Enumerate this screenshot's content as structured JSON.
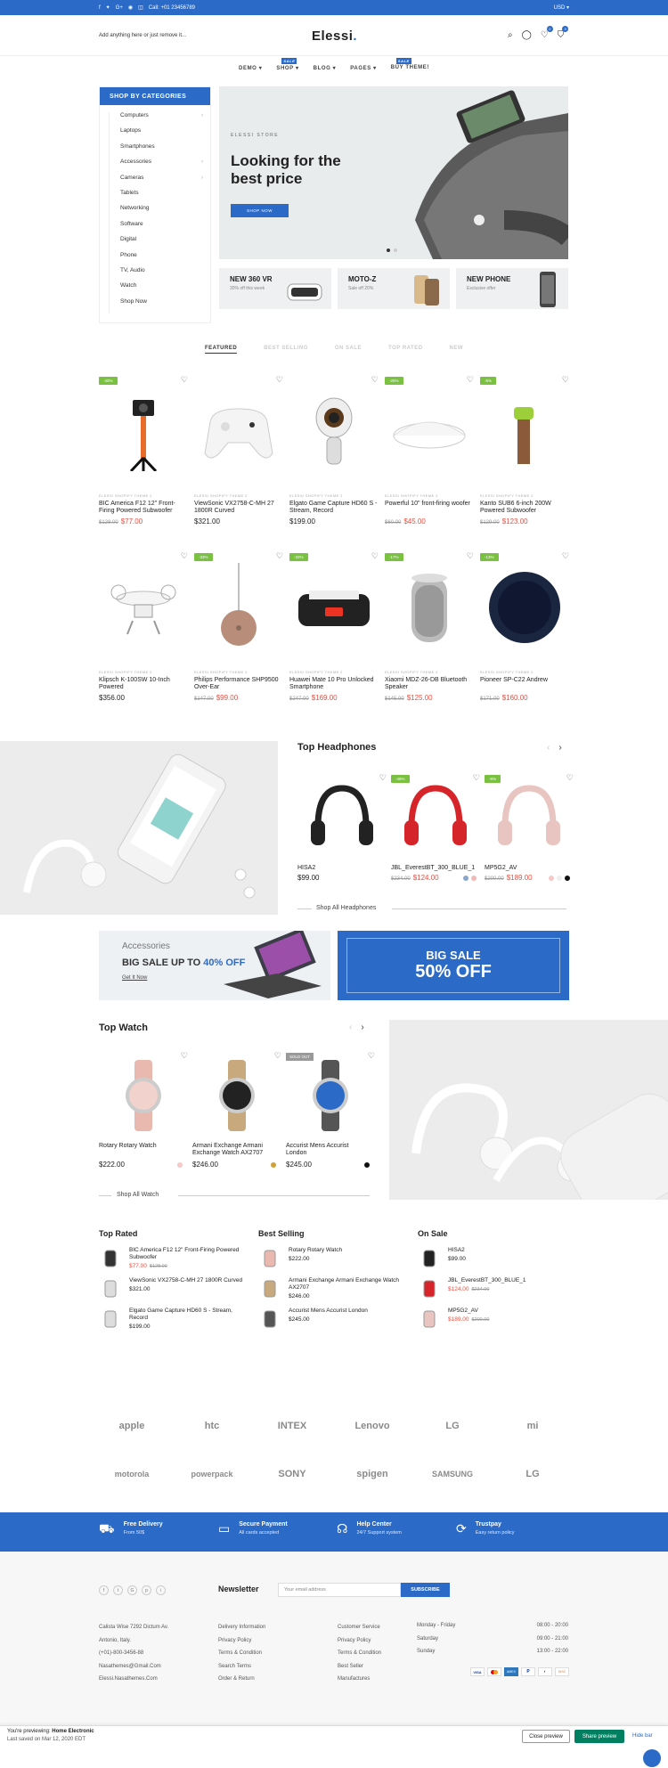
{
  "topbar": {
    "call": "Call: +01 23456789",
    "currency": "USD"
  },
  "header": {
    "search_placeholder": "Add anything here or just remove it...",
    "logo": "Elessi",
    "cart_count": "0",
    "wish_count": "0"
  },
  "nav": {
    "items": [
      {
        "label": "DEMO",
        "tag": ""
      },
      {
        "label": "SHOP",
        "tag": "SALE"
      },
      {
        "label": "BLOG",
        "tag": ""
      },
      {
        "label": "PAGES",
        "tag": ""
      },
      {
        "label": "BUY THEME!",
        "tag": "SALE"
      }
    ]
  },
  "categories": {
    "title": "SHOP BY CATEGORIES",
    "items": [
      "Computers",
      "Laptops",
      "Smartphones",
      "Accessories",
      "Cameras",
      "Tablets",
      "Networking",
      "Software",
      "Digital",
      "Phone",
      "TV, Audio",
      "Watch",
      "Shop Now"
    ]
  },
  "slider": {
    "subtitle": "ELESSI STORE",
    "title": "Looking for the best price",
    "button": "SHOP NOW"
  },
  "promos": [
    {
      "title": "NEW 360 VR",
      "sub": "30% off this week"
    },
    {
      "title": "MOTO-Z",
      "sub": "Sale off 20%"
    },
    {
      "title": "NEW PHONE",
      "sub": "Exclusive offer"
    }
  ],
  "tabs": [
    "FEATURED",
    "BEST SELLING",
    "ON SALE",
    "TOP RATED",
    "NEW"
  ],
  "products": [
    {
      "vendor": "ELESSI SHOPIFY THEME 2",
      "name": "BIC America F12 12\" Front-Firing Powered Subwoofer",
      "old": "$128.00",
      "price": "$77.00",
      "sale": "-40%"
    },
    {
      "vendor": "ELESSI SHOPIFY THEME 2",
      "name": "ViewSonic VX2758-C-MH 27 1800R Curved",
      "old": "",
      "price": "$321.00",
      "sale": ""
    },
    {
      "vendor": "ELESSI SHOPIFY THEME 2",
      "name": "Elgato Game Capture HD60 S - Stream, Record",
      "old": "",
      "price": "$199.00",
      "sale": ""
    },
    {
      "vendor": "ELESSI SHOPIFY THEME 2",
      "name": "Powerful 10\" front-firing woofer",
      "old": "$60.00",
      "price": "$45.00",
      "sale": "-25%"
    },
    {
      "vendor": "ELESSI SHOPIFY THEME 2",
      "name": "Kanto SUB6 6-inch 200W Powered Subwoofer",
      "old": "$129.00",
      "price": "$123.00",
      "sale": "-5%"
    },
    {
      "vendor": "ELESSI SHOPIFY THEME 2",
      "name": "Klipsch K-100SW 10-Inch Powered",
      "old": "",
      "price": "$356.00",
      "sale": ""
    },
    {
      "vendor": "ELESSI SHOPIFY THEME 2",
      "name": "Philips Performance SHP9500 Over-Ear",
      "old": "$147.00",
      "price": "$99.00",
      "sale": "-33%"
    },
    {
      "vendor": "ELESSI SHOPIFY THEME 2",
      "name": "Huawei Mate 10 Pro Unlocked Smartphone",
      "old": "$247.00",
      "price": "$169.00",
      "sale": "-32%"
    },
    {
      "vendor": "ELESSI SHOPIFY THEME 2",
      "name": "Xiaomi MDZ-26-DB Bluetooth Speaker",
      "old": "$145.00",
      "price": "$125.00",
      "sale": "-17%"
    },
    {
      "vendor": "ELESSI SHOPIFY THEME 2",
      "name": "Pioneer SP-C22 Andrew",
      "old": "$171.00",
      "price": "$160.00",
      "sale": "-13%"
    }
  ],
  "headphones": {
    "title": "Top Headphones",
    "shop_all": "Shop All Headphones",
    "items": [
      {
        "name": "HISA2",
        "old": "",
        "price": "$99.00",
        "sale": ""
      },
      {
        "name": "JBL_EverestBT_300_BLUE_1",
        "old": "$234.00",
        "price": "$124.00",
        "sale": "-46%"
      },
      {
        "name": "MP5G2_AV",
        "old": "$200.00",
        "price": "$189.00",
        "sale": "-6%"
      }
    ]
  },
  "banners": {
    "b1_kicker": "Accessories",
    "b1_title_a": "BIG SALE UP TO ",
    "b1_title_b": "40% OFF",
    "b1_link": "Get It Now",
    "b2_title": "BIG SALE",
    "b2_off": "50% OFF"
  },
  "watch": {
    "title": "Top Watch",
    "shop_all": "Shop All Watch",
    "items": [
      {
        "name": "Rotary Rotary Watch",
        "price": "$222.00",
        "tag": ""
      },
      {
        "name": "Armani Exchange Armani Exchange Watch AX2707",
        "price": "$246.00",
        "tag": ""
      },
      {
        "name": "Accurist Mens Accurist London",
        "price": "$245.00",
        "tag": "SOLD OUT"
      }
    ]
  },
  "lists": [
    {
      "title": "Top Rated",
      "items": [
        {
          "name": "BIC America F12 12\" Front-Firing Powered Subwoofer",
          "price": "$77.00",
          "old": "$128.00"
        },
        {
          "name": "ViewSonic VX2758-C-MH 27 1800R Curved",
          "price": "$321.00",
          "old": ""
        },
        {
          "name": "Elgato Game Capture HD60 S - Stream, Record",
          "price": "$199.00",
          "old": ""
        }
      ]
    },
    {
      "title": "Best Selling",
      "items": [
        {
          "name": "Rotary Rotary Watch",
          "price": "$222.00",
          "old": ""
        },
        {
          "name": "Armani Exchange Armani Exchange Watch AX2707",
          "price": "$246.00",
          "old": ""
        },
        {
          "name": "Accurist Mens Accurist London",
          "price": "$245.00",
          "old": ""
        }
      ]
    },
    {
      "title": "On Sale",
      "items": [
        {
          "name": "HISA2",
          "price": "$99.00",
          "old": ""
        },
        {
          "name": "JBL_EverestBT_300_BLUE_1",
          "price": "$124.00",
          "old": "$234.00"
        },
        {
          "name": "MP5G2_AV",
          "price": "$189.00",
          "old": "$200.00"
        }
      ]
    }
  ],
  "brands": [
    "apple",
    "htc",
    "INTEX",
    "Lenovo",
    "LG",
    "mi",
    "motorola",
    "powerpack",
    "SONY",
    "spigen",
    "SAMSUNG",
    "LG"
  ],
  "features": [
    {
      "title": "Free Delivery",
      "sub": "From 50$"
    },
    {
      "title": "Secure Payment",
      "sub": "All cards accepted"
    },
    {
      "title": "Help Center",
      "sub": "24/7 Support system"
    },
    {
      "title": "Trustpay",
      "sub": "Easy return policy"
    }
  ],
  "footer": {
    "newsletter": "Newsletter",
    "email_placeholder": "Your email address",
    "subscribe": "SUBSCRIBE",
    "address": [
      "Calista Wise 7292 Dictum Av.",
      "Antonio, Italy.",
      "(+01)-800-3456-88",
      "Nasathemes@Gmail.Com",
      "Elessi.Nasathemes.Com"
    ],
    "col2": [
      "Delivery Information",
      "Privacy Policy",
      "Terms & Condition",
      "Search Terms",
      "Order & Return"
    ],
    "col3": [
      "Customer Service",
      "Privacy Policy",
      "Terms & Condition",
      "Best Seller",
      "Manufactures"
    ],
    "hours": [
      {
        "day": "Monday - Friday",
        "time": "08:00 - 20:00"
      },
      {
        "day": "Saturday",
        "time": "09:00 - 21:00"
      },
      {
        "day": "Sunday",
        "time": "13:00 - 22:00"
      }
    ]
  },
  "preview": {
    "previewing_prefix": "You're previewing: ",
    "theme": "Home Electronic",
    "saved": "Last saved on Mar 12, 2020 EDT",
    "close": "Close preview",
    "share": "Share preview",
    "hide": "Hide bar"
  },
  "colors": {
    "accent": "#2b6ac6",
    "sale_green": "#7ac142",
    "price_red": "#e95144"
  }
}
